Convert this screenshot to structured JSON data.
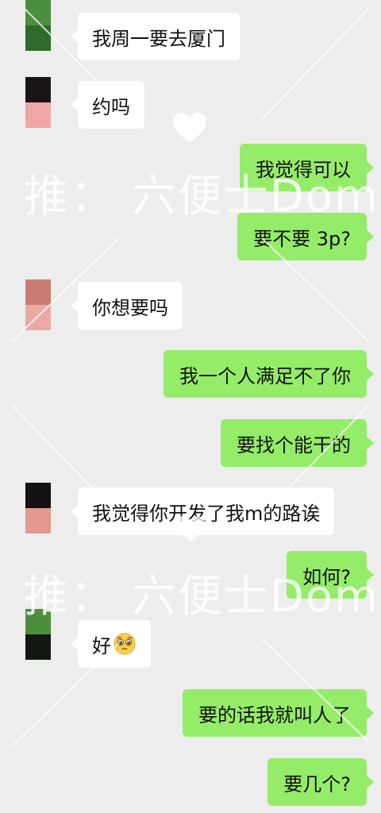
{
  "messages": [
    {
      "side": "incoming",
      "text": "我周一要去厦门",
      "avatar_colors": [
        "#4a8f3f",
        "#2f6b2a"
      ]
    },
    {
      "side": "incoming",
      "text": "约吗",
      "avatar_colors": [
        "#1a1418",
        "#eea6a6"
      ]
    },
    {
      "side": "outgoing",
      "text": "我觉得可以"
    },
    {
      "side": "outgoing",
      "text": "要不要 3p?"
    },
    {
      "side": "incoming",
      "text": "你想要吗",
      "avatar_colors": [
        "#cc7b74",
        "#eaa9a3"
      ]
    },
    {
      "side": "outgoing",
      "text": "我一个人满足不了你"
    },
    {
      "side": "outgoing",
      "text": "要找个能干的"
    },
    {
      "side": "incoming",
      "text": "我觉得你开发了我m的路诶",
      "avatar_colors": [
        "#141214",
        "#e39892"
      ]
    },
    {
      "side": "outgoing",
      "text": "如何?"
    },
    {
      "side": "incoming",
      "text": "好",
      "emoji": "pleading-face-emoji",
      "avatar_colors": [
        "#4b8f3d",
        "#121811"
      ]
    },
    {
      "side": "outgoing",
      "text": "要的话我就叫人了"
    },
    {
      "side": "outgoing",
      "text": "要几个?"
    }
  ],
  "watermark": {
    "text": "推：  六便士Dom"
  },
  "colors": {
    "background": "#ededed",
    "incoming_bubble": "#ffffff",
    "outgoing_bubble": "#95ec69"
  }
}
